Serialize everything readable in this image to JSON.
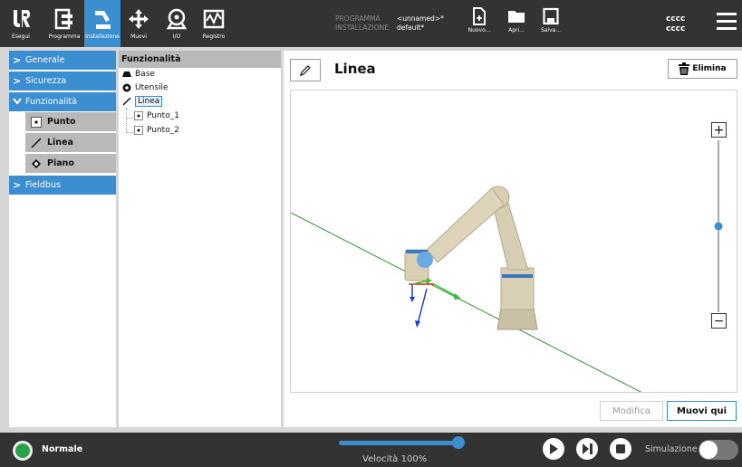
{
  "header": {
    "nav": [
      {
        "label": "Esegui",
        "icon": "ur-logo-icon"
      },
      {
        "label": "Programma",
        "icon": "program-icon"
      },
      {
        "label": "Installazione",
        "icon": "robot-arm-icon"
      },
      {
        "label": "Muovi",
        "icon": "move-arrows-icon"
      },
      {
        "label": "I/O",
        "icon": "io-icon"
      },
      {
        "label": "Registro",
        "icon": "log-icon"
      }
    ],
    "program_key": "PROGRAMMA",
    "program_val": "<unnamed>*",
    "install_key": "INSTALLAZIONE",
    "install_val": "default*",
    "file_buttons": [
      {
        "label": "Nuovo...",
        "icon": "new-file-icon"
      },
      {
        "label": "Apri...",
        "icon": "open-folder-icon"
      },
      {
        "label": "Salva...",
        "icon": "save-icon"
      }
    ],
    "user_line1": "cccc",
    "user_line2": "cccc"
  },
  "sidebar": {
    "items": [
      {
        "label": "Generale",
        "expanded": false
      },
      {
        "label": "Sicurezza",
        "expanded": false
      },
      {
        "label": "Funzionalità",
        "expanded": true
      },
      {
        "label": "Fieldbus",
        "expanded": false
      }
    ],
    "sub_items": [
      {
        "label": "Punto",
        "icon": "point-icon"
      },
      {
        "label": "Linea",
        "icon": "line-icon"
      },
      {
        "label": "Piano",
        "icon": "plane-icon"
      }
    ]
  },
  "tree": {
    "header": "Funzionalità",
    "nodes": [
      {
        "label": "Base",
        "icon": "base-icon"
      },
      {
        "label": "Utensile",
        "icon": "tool-icon"
      },
      {
        "label": "Linea",
        "icon": "line-icon",
        "selected": true
      },
      {
        "label": "Punto_1",
        "icon": "point-icon"
      },
      {
        "label": "Punto_2",
        "icon": "point-icon"
      }
    ]
  },
  "main": {
    "title": "Linea",
    "delete_label": "Elimina",
    "zoom_in": "+",
    "zoom_out": "−",
    "zoom_level": 0.5,
    "modify_label": "Modifica",
    "move_here_label": "Muovi qui"
  },
  "footer": {
    "status": "Normale",
    "speed_label": "Velocità 100%",
    "speed_fraction": 1.0,
    "sim_label": "Simulazione",
    "sim_on": false
  },
  "colors": {
    "accent": "#3b8fd0",
    "topbar": "#333333",
    "status_green": "#2aa24a"
  }
}
